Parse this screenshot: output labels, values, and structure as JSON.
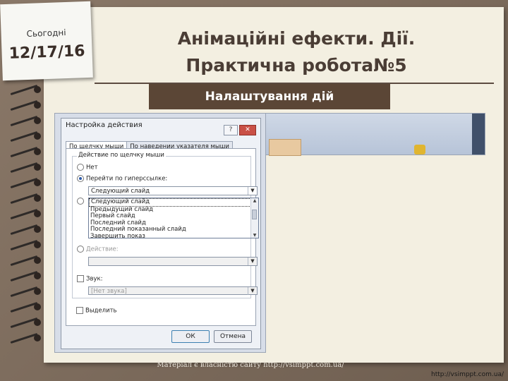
{
  "sidebar_note": {
    "label": "Сьогодні",
    "date": "12/17/16"
  },
  "title_line1": "Анімаційні ефекти. Дії.",
  "title_line2": "Практична робота№5",
  "banner": "Налаштування дій",
  "dialog": {
    "title": "Настройка действия",
    "title_buttons": [
      "?",
      "✕"
    ],
    "tabs": [
      "По щелчку мыши",
      "По наведении указателя мыши"
    ],
    "group_label": "Действие по щелчку мыши",
    "option_none": "Нет",
    "option_hyperlink": "Перейти по гиперссылке:",
    "hyperlink_value": "Следующий слайд",
    "dropdown_items": [
      "Следующий слайд",
      "Предыдущий слайд",
      "Первый слайд",
      "Последний слайд",
      "Последний показанный слайд",
      "Завершить показ"
    ],
    "option_action": "Действие:",
    "sound_label": "Звук:",
    "sound_value": "[Нет звука]",
    "highlight_label": "Выделить",
    "ok": "ОК",
    "cancel": "Отмена"
  },
  "footer": "Матеріал є власністю сайту http://vsimppt.com.ua/",
  "url": "http://vsimppt.com.ua/"
}
